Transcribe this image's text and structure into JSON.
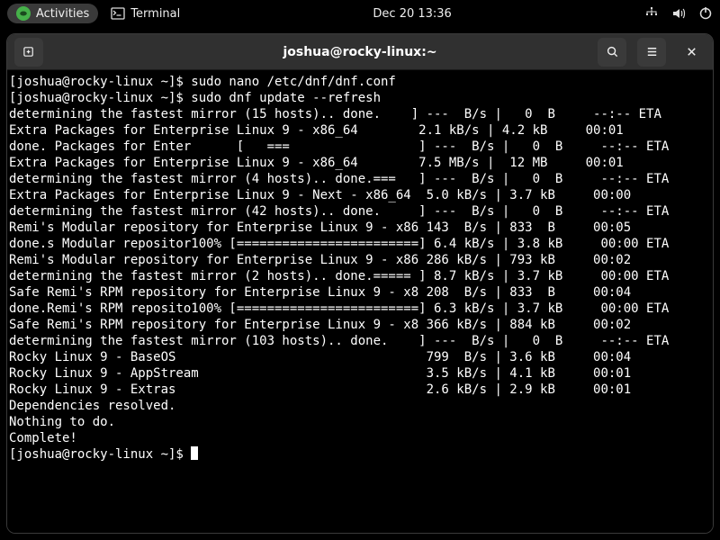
{
  "topbar": {
    "activities": "Activities",
    "terminal": "Terminal",
    "clock": "Dec 20  13:36"
  },
  "window": {
    "title": "joshua@rocky-linux:~"
  },
  "prompt": "[joshua@rocky-linux ~]$ ",
  "lines": [
    "[joshua@rocky-linux ~]$ sudo nano /etc/dnf/dnf.conf",
    "[joshua@rocky-linux ~]$ sudo dnf update --refresh",
    "determining the fastest mirror (15 hosts).. done.    ] ---  B/s |   0  B     --:-- ETA",
    "Extra Packages for Enterprise Linux 9 - x86_64        2.1 kB/s | 4.2 kB     00:01",
    "done. Packages for Enter      [   ===                 ] ---  B/s |   0  B     --:-- ETA",
    "Extra Packages for Enterprise Linux 9 - x86_64        7.5 MB/s |  12 MB     00:01",
    "determining the fastest mirror (4 hosts).. done.===   ] ---  B/s |   0  B     --:-- ETA",
    "Extra Packages for Enterprise Linux 9 - Next - x86_64  5.0 kB/s | 3.7 kB     00:00",
    "determining the fastest mirror (42 hosts).. done.     ] ---  B/s |   0  B     --:-- ETA",
    "Remi's Modular repository for Enterprise Linux 9 - x86 143  B/s | 833  B     00:05",
    "done.s Modular repositor100% [========================] 6.4 kB/s | 3.8 kB     00:00 ETA",
    "Remi's Modular repository for Enterprise Linux 9 - x86 286 kB/s | 793 kB     00:02",
    "determining the fastest mirror (2 hosts).. done.===== ] 8.7 kB/s | 3.7 kB     00:00 ETA",
    "Safe Remi's RPM repository for Enterprise Linux 9 - x8 208  B/s | 833  B     00:04",
    "done.Remi's RPM reposito100% [========================] 6.3 kB/s | 3.7 kB     00:00 ETA",
    "Safe Remi's RPM repository for Enterprise Linux 9 - x8 366 kB/s | 884 kB     00:02",
    "determining the fastest mirror (103 hosts).. done.    ] ---  B/s |   0  B     --:-- ETA",
    "Rocky Linux 9 - BaseOS                                 799  B/s | 3.6 kB     00:04",
    "Rocky Linux 9 - AppStream                              3.5 kB/s | 4.1 kB     00:01",
    "Rocky Linux 9 - Extras                                 2.6 kB/s | 2.9 kB     00:01",
    "Dependencies resolved.",
    "Nothing to do.",
    "Complete!"
  ]
}
